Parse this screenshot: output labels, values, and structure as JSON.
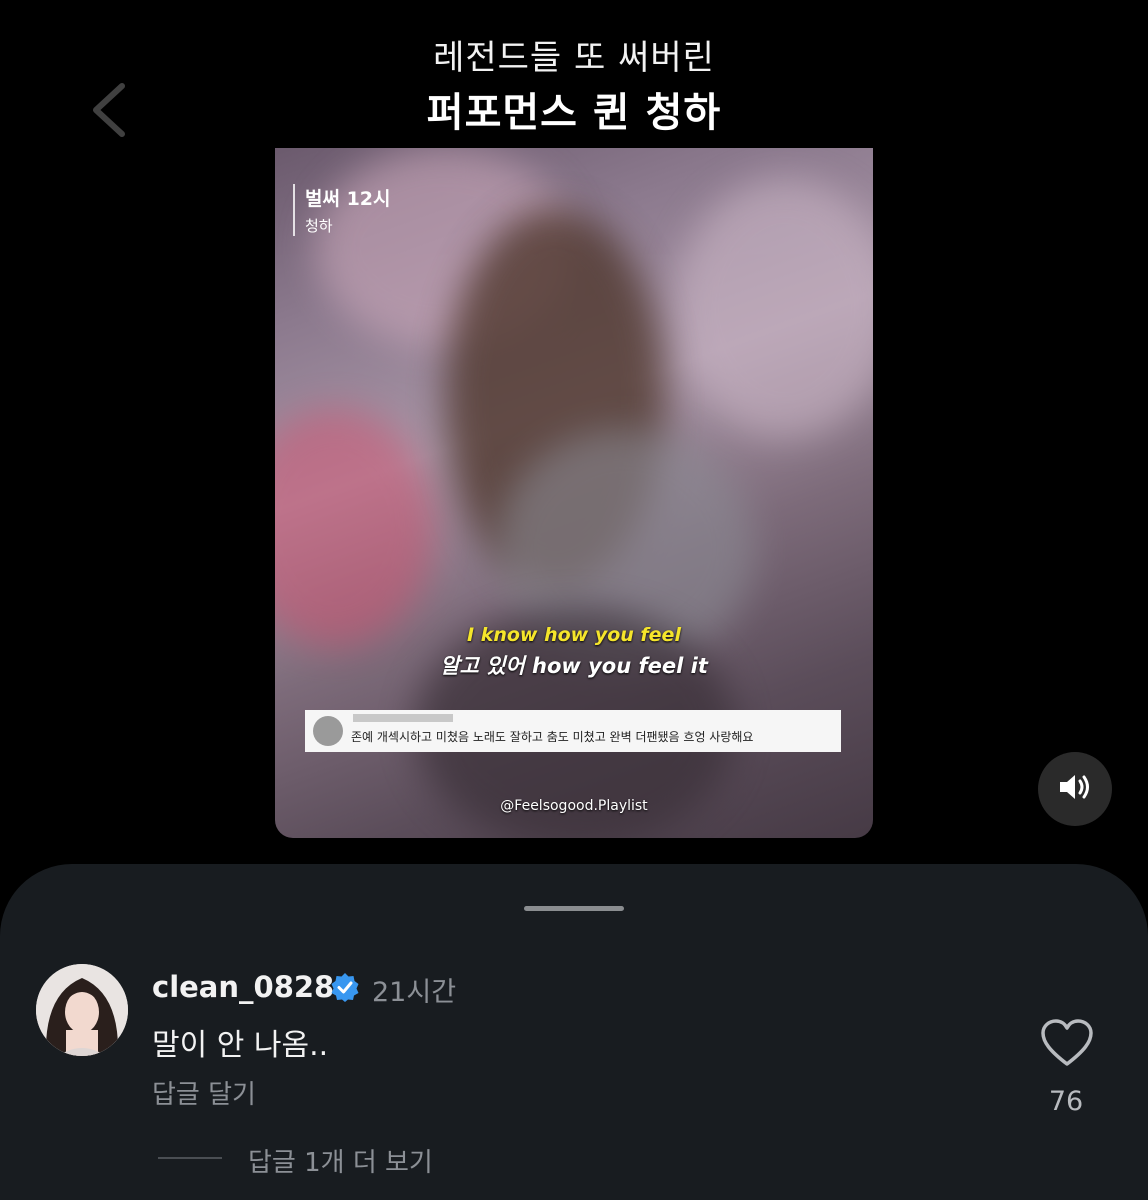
{
  "video": {
    "headline_line1": "레전드들 또 써버린",
    "headline_line2": "퍼포먼스 퀸 청하",
    "song_title": "벌써 12시",
    "song_artist": "청하",
    "subtitle_en": "I know how you feel",
    "subtitle_ko": "알고 있어 how you feel it",
    "embedded_comment": "존예 개섹시하고 미쳤음 노래도 잘하고 춤도 미쳤고 완벽 더팬됐음 흐엉 사랑해요",
    "watermark": "@Feelsogood.Playlist",
    "back_icon": "chevron-left-icon",
    "sound_icon": "speaker-icon"
  },
  "comment": {
    "username": "clean_0828",
    "verified_icon": "verified-badge-icon",
    "time": "21시간",
    "text": "말이 안 나옴..",
    "reply_label": "답글 달기",
    "like_icon": "heart-icon",
    "like_count": "76",
    "more_replies": "답글 1개 더 보기"
  },
  "colors": {
    "background": "#000000",
    "sheet": "#181c20",
    "verified": "#3897f0",
    "secondary_text": "#8c9096"
  }
}
